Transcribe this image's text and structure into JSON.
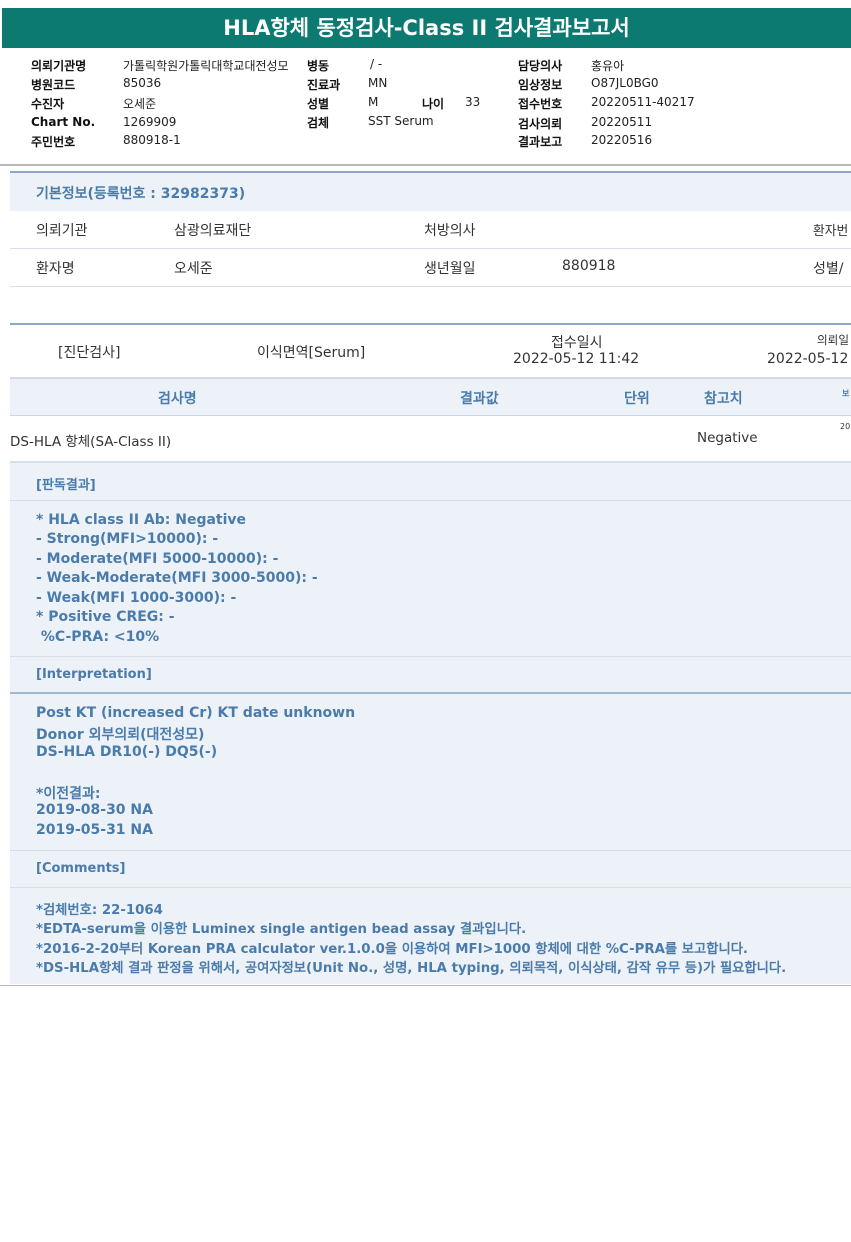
{
  "title": "HLA항체 동정검사-Class II 검사결과보고서",
  "header": {
    "inst_label": "의뢰기관명",
    "inst_value": "가톨릭학원가톨릭대학교대전성모",
    "ward_label": "병동",
    "ward_value": "/ -",
    "doctor_label": "담당의사",
    "doctor_value": "홍유아",
    "hosp_code_label": "병원코드",
    "hosp_code_value": "85036",
    "dept_label": "진료과",
    "dept_value": "MN",
    "clinical_label": "임상정보",
    "clinical_value": "O87JL0BG0",
    "examinee_label": "수진자",
    "examinee_value": "오세준",
    "sex_label": "성별",
    "sex_value": "M",
    "age_label": "나이",
    "age_value": "33",
    "receipt_no_label": "접수번호",
    "receipt_no_value": "20220511-40217",
    "chart_label": "Chart No.",
    "chart_value": "1269909",
    "specimen_label": "검체",
    "specimen_value": "SST Serum",
    "request_label": "검사의뢰",
    "request_value": "20220511",
    "rrn_label": "주민번호",
    "rrn_value": "880918-1",
    "report_label": "결과보고",
    "report_value": "20220516"
  },
  "basic": {
    "heading": "기본정보(등록번호 : 32982373)",
    "inst_label": "의뢰기관",
    "inst_value": "삼광의료재단",
    "prescriber_label": "처방의사",
    "prescriber_value": "",
    "patient_no_label": "환자번",
    "name_label": "환자명",
    "name_value": "오세준",
    "dob_label": "생년월일",
    "dob_value": "880918",
    "sex_label": "성별/"
  },
  "order": {
    "category": "[진단검사]",
    "sample": "이식면역[Serum]",
    "received_label": "접수일시",
    "received_value": "2022-05-12  11:42",
    "requested_label": "의뢰일",
    "requested_value": "2022-05-12"
  },
  "table": {
    "headers": [
      "검사명",
      "결과값",
      "단위",
      "참고치",
      "보"
    ],
    "rows": [
      {
        "name": "DS-HLA 항체(SA-Class II)",
        "result": "",
        "unit": "",
        "reference": "Negative",
        "extra": "20"
      }
    ]
  },
  "judgement": {
    "heading": "[판독결과]",
    "lines": [
      "* HLA class II Ab: Negative",
      "- Strong(MFI>10000): -",
      "- Moderate(MFI 5000-10000): -",
      "- Weak-Moderate(MFI 3000-5000): -",
      "- Weak(MFI 1000-3000): -",
      "* Positive CREG: -",
      " %C-PRA: <10%"
    ]
  },
  "interpretation": {
    "heading": "[Interpretation]",
    "lines": [
      "Post KT (increased Cr) KT date unknown",
      "Donor 외부의뢰(대전성모)",
      "DS-HLA DR10(-) DQ5(-)",
      "",
      "*이전결과:",
      "2019-08-30 NA",
      "2019-05-31 NA"
    ]
  },
  "comments": {
    "heading": "[Comments]",
    "lines": [
      "*검체번호: 22-1064",
      "*EDTA-serum을 이용한 Luminex single antigen bead assay 결과입니다.",
      "*2016-2-20부터 Korean PRA calculator ver.1.0.0을 이용하여 MFI>1000 항체에 대한 %C-PRA를 보고합니다.",
      "*DS-HLA항체 결과 판정을 위해서, 공여자정보(Unit No., 성명, HLA typing, 의뢰목적, 이식상태, 감작 유무 등)가 필요합니다."
    ]
  }
}
